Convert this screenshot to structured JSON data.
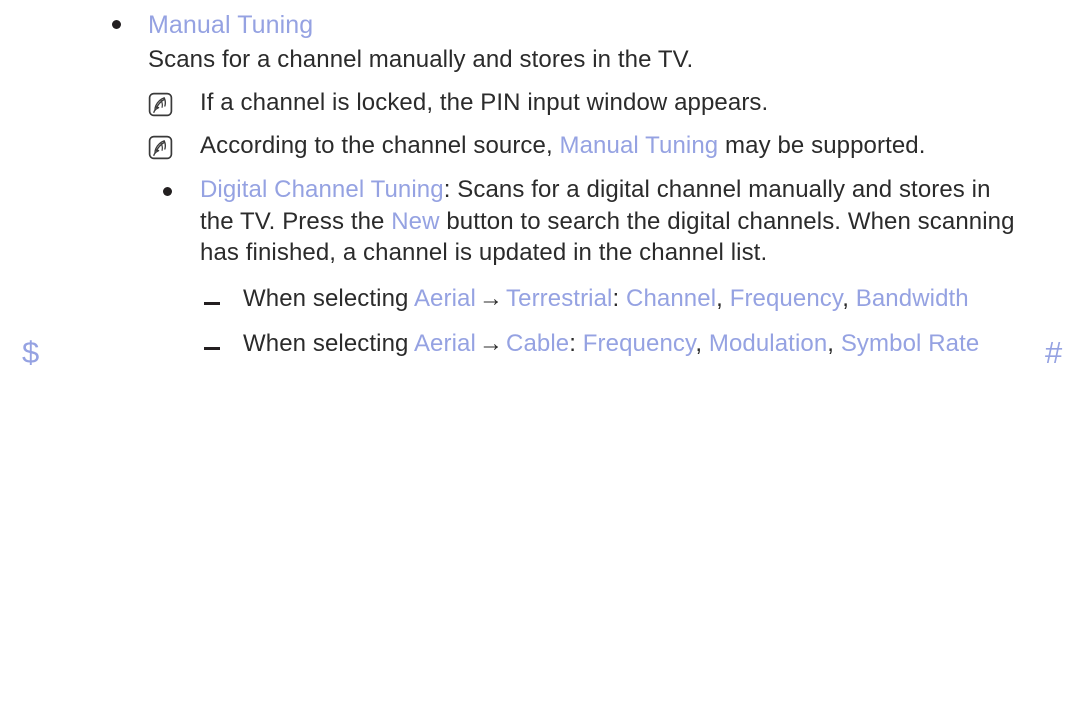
{
  "colors": {
    "accent_blue": "#95a2e2",
    "body_text": "#2b2b2b",
    "bullet": "#231f20",
    "background": "#ffffff"
  },
  "nav": {
    "prev_marker": "$",
    "next_marker": "#"
  },
  "section": {
    "title": "Manual Tuning",
    "description": "Scans for a channel manually and stores in the TV."
  },
  "notes": [
    {
      "icon": "note-icon",
      "text": "If a channel is locked, the PIN input window appears."
    },
    {
      "icon": "note-icon",
      "prefix": "According to the channel source, ",
      "highlight": "Manual Tuning",
      "suffix": " may be supported."
    }
  ],
  "sub_items": [
    {
      "term": "Digital Channel Tuning",
      "colon": ":",
      "text_part_1": " Scans for a digital channel manually and stores in the TV. Press the ",
      "inline_highlight": "New",
      "text_part_2": " button to search the digital channels. When scanning has finished, a channel is updated in the channel list."
    }
  ],
  "detail_items": [
    {
      "lead": "When selecting ",
      "source": "Aerial",
      "arrow": "→",
      "target": "Terrestrial",
      "colon": ":",
      "fields": [
        "Channel",
        "Frequency",
        "Bandwidth"
      ],
      "separator": ", "
    },
    {
      "lead": "When selecting ",
      "source": "Aerial",
      "arrow": "→",
      "target": "Cable",
      "colon": ":",
      "fields": [
        "Frequency",
        "Modulation",
        "Symbol Rate"
      ],
      "separator": ", "
    }
  ]
}
